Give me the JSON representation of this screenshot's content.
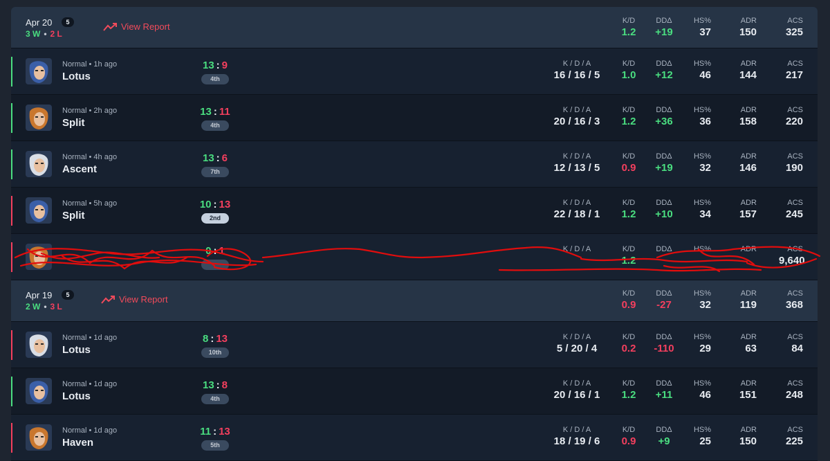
{
  "days": [
    {
      "date": "Apr 20",
      "count": "5",
      "wins": "3 W",
      "losses": "2 L",
      "view_report": "View Report",
      "stats": {
        "kd": "1.2",
        "dd": "+19",
        "hs": "37",
        "adr": "150",
        "acs": "325"
      }
    },
    {
      "date": "Apr 19",
      "count": "5",
      "wins": "2 W",
      "losses": "3 L",
      "view_report": "View Report",
      "stats": {
        "kd": "0.9",
        "dd": "-27",
        "hs": "32",
        "adr": "119",
        "acs": "368"
      }
    }
  ],
  "labels": {
    "kda": "K / D / A",
    "kd": "K/D",
    "dd": "DDΔ",
    "hs": "HS%",
    "adr": "ADR",
    "acs": "ACS"
  },
  "matches": [
    {
      "meta": "Normal • 1h ago",
      "map": "Lotus",
      "score_a": "13",
      "score_b": "9",
      "place": "4th",
      "kda": "16 / 16 / 5",
      "kd": "1.0",
      "dd": "+12",
      "hs": "46",
      "adr": "144",
      "acs": "217",
      "result": "win"
    },
    {
      "meta": "Normal • 2h ago",
      "map": "Split",
      "score_a": "13",
      "score_b": "11",
      "place": "4th",
      "kda": "20 / 16 / 3",
      "kd": "1.2",
      "dd": "+36",
      "hs": "36",
      "adr": "158",
      "acs": "220",
      "result": "win"
    },
    {
      "meta": "Normal • 4h ago",
      "map": "Ascent",
      "score_a": "13",
      "score_b": "6",
      "place": "7th",
      "kda": "12 / 13 / 5",
      "kd": "0.9",
      "dd": "+19",
      "hs": "32",
      "adr": "146",
      "acs": "190",
      "result": "win"
    },
    {
      "meta": "Normal • 5h ago",
      "map": "Split",
      "score_a": "10",
      "score_b": "13",
      "place": "2nd",
      "kda": "22 / 18 / 1",
      "kd": "1.2",
      "dd": "+10",
      "hs": "34",
      "adr": "157",
      "acs": "245",
      "result": "loss"
    },
    {
      "meta": "",
      "map": "",
      "score_a": "0",
      "score_b": "1",
      "place": "",
      "kda": "",
      "kd": "1.2",
      "dd": "",
      "hs": "",
      "adr": "",
      "acs": "9,640",
      "result": "loss"
    },
    {
      "meta": "Normal • 1d ago",
      "map": "Lotus",
      "score_a": "8",
      "score_b": "13",
      "place": "10th",
      "kda": "5 / 20 / 4",
      "kd": "0.2",
      "dd": "-110",
      "hs": "29",
      "adr": "63",
      "acs": "84",
      "result": "loss"
    },
    {
      "meta": "Normal • 1d ago",
      "map": "Lotus",
      "score_a": "13",
      "score_b": "8",
      "place": "4th",
      "kda": "20 / 16 / 1",
      "kd": "1.2",
      "dd": "+11",
      "hs": "46",
      "adr": "151",
      "acs": "248",
      "result": "win"
    },
    {
      "meta": "Normal • 1d ago",
      "map": "Haven",
      "score_a": "11",
      "score_b": "13",
      "place": "5th",
      "kda": "18 / 19 / 6",
      "kd": "0.9",
      "dd": "+9",
      "hs": "25",
      "adr": "150",
      "acs": "225",
      "result": "loss"
    }
  ],
  "colors": {
    "win": "#4ade80",
    "loss": "#f43f5e",
    "accent": "#f24b5b"
  }
}
